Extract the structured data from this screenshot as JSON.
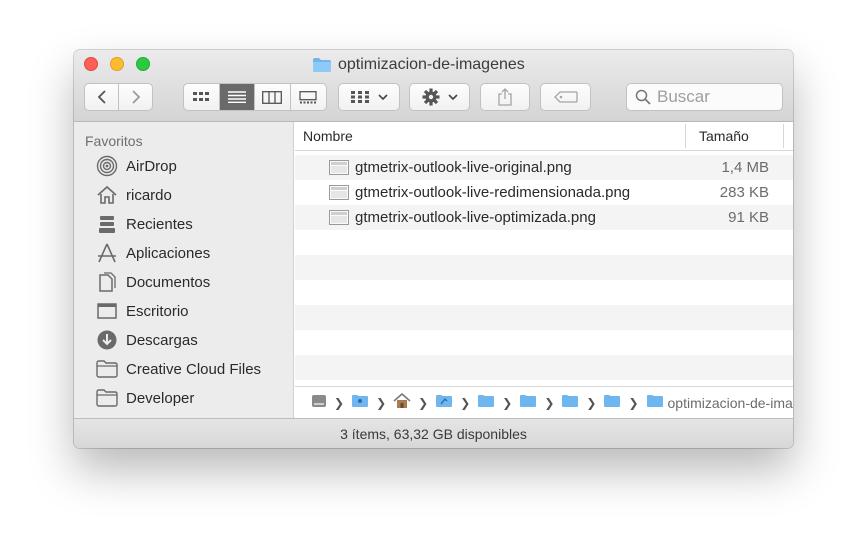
{
  "window": {
    "title": "optimizacion-de-imagenes"
  },
  "toolbar": {
    "search_placeholder": "Buscar"
  },
  "sidebar": {
    "section_title": "Favoritos",
    "items": [
      {
        "label": "AirDrop",
        "icon": "airdrop-icon"
      },
      {
        "label": "ricardo",
        "icon": "home-icon"
      },
      {
        "label": "Recientes",
        "icon": "recents-icon"
      },
      {
        "label": "Aplicaciones",
        "icon": "applications-icon"
      },
      {
        "label": "Documentos",
        "icon": "documents-icon"
      },
      {
        "label": "Escritorio",
        "icon": "desktop-icon"
      },
      {
        "label": "Descargas",
        "icon": "downloads-icon"
      },
      {
        "label": "Creative Cloud Files",
        "icon": "folder-icon"
      },
      {
        "label": "Developer",
        "icon": "folder-icon"
      }
    ]
  },
  "list": {
    "columns": {
      "name": "Nombre",
      "size": "Tamaño"
    },
    "files": [
      {
        "name": "gtmetrix-outlook-live-original.png",
        "size": "1,4 MB"
      },
      {
        "name": "gtmetrix-outlook-live-redimensionada.png",
        "size": "283 KB"
      },
      {
        "name": "gtmetrix-outlook-live-optimizada.png",
        "size": "91 KB"
      }
    ]
  },
  "pathbar": {
    "current": "optimizacion-de-ima"
  },
  "status": {
    "text": "3 ítems, 63,32 GB disponibles"
  },
  "colors": {
    "folder_blue": "#6fb6ee",
    "active_view": "#6a6a6a"
  }
}
